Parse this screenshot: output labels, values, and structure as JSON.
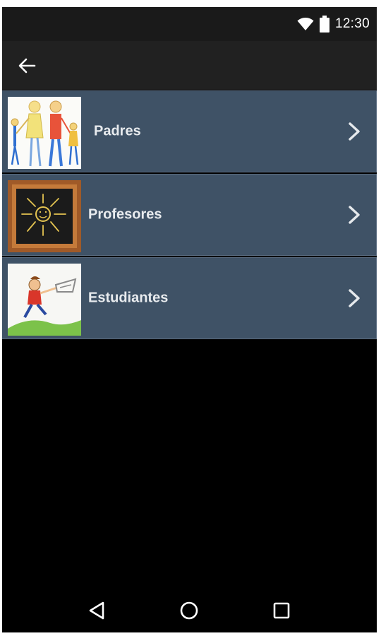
{
  "status_bar": {
    "time": "12:30",
    "icons": [
      "wifi-icon",
      "battery-icon"
    ]
  },
  "app_bar": {
    "back_icon": "arrow-left-icon"
  },
  "menu": {
    "items": [
      {
        "label": "Padres",
        "image": "family-drawing",
        "chevron": "chevron-right-icon"
      },
      {
        "label": "Profesores",
        "image": "chalkboard-sun-drawing",
        "chevron": "chevron-right-icon"
      },
      {
        "label": "Estudiantes",
        "image": "running-student-drawing",
        "chevron": "chevron-right-icon"
      }
    ]
  },
  "nav_bar": {
    "buttons": [
      "back-triangle-icon",
      "home-circle-icon",
      "recents-square-icon"
    ]
  },
  "colors": {
    "item_background": "#3f5266",
    "app_bar": "#212121",
    "status_bar": "#1a1a1a",
    "screen": "#000000"
  }
}
